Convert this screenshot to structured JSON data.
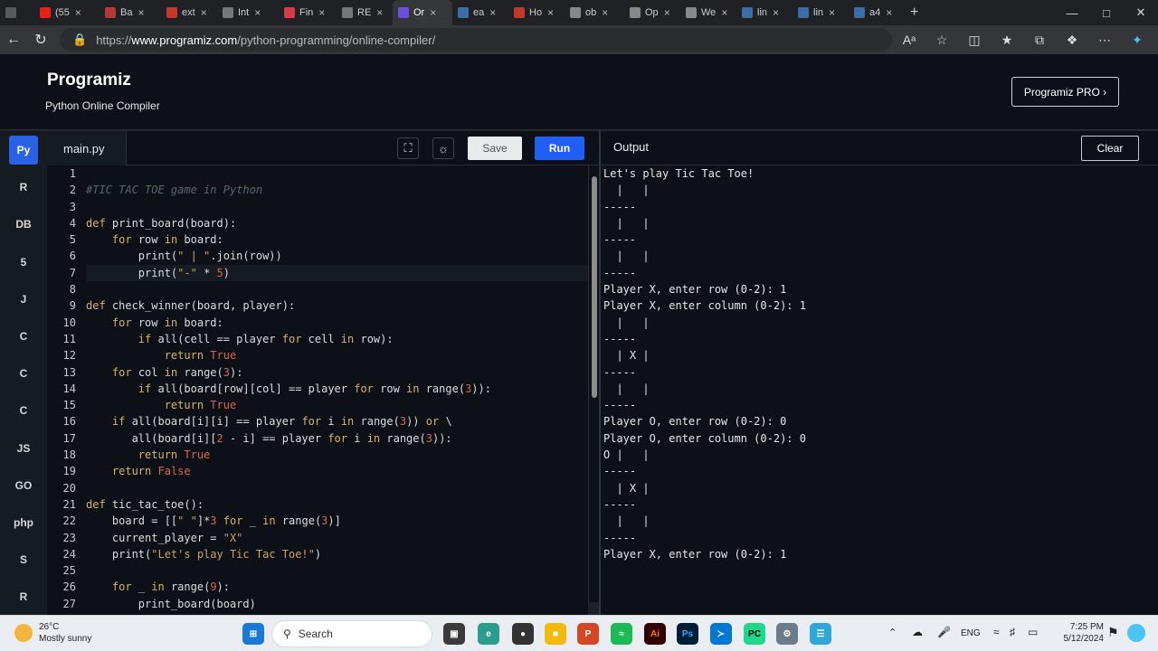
{
  "browser": {
    "tabs": [
      {
        "label": "",
        "color": "#5a5a5a"
      },
      {
        "label": "(55",
        "color": "#e62117"
      },
      {
        "label": "Ba",
        "color": "#b23a3a"
      },
      {
        "label": "ext",
        "color": "#c0392b"
      },
      {
        "label": "Int",
        "color": "#777777"
      },
      {
        "label": "Fin",
        "color": "#d33c4b"
      },
      {
        "label": "RE",
        "color": "#777777"
      },
      {
        "label": "Or",
        "color": "#6b4fd8"
      },
      {
        "label": "ea",
        "color": "#3a6ea5"
      },
      {
        "label": "Ho",
        "color": "#c0392b"
      },
      {
        "label": "ob",
        "color": "#888888"
      },
      {
        "label": "Op",
        "color": "#888888"
      },
      {
        "label": "We",
        "color": "#888888"
      },
      {
        "label": "lin",
        "color": "#3a6ea5"
      },
      {
        "label": "lin",
        "color": "#3a6ea5"
      },
      {
        "label": "a4",
        "color": "#3a6ea5"
      }
    ],
    "url_prefix": "https://",
    "url_domain": "www.programiz.com",
    "url_path": "/python-programming/online-compiler/"
  },
  "site": {
    "logo": "Programiz",
    "subtitle": "Python Online Compiler",
    "pro_button": "Programiz PRO ›"
  },
  "sidebar": {
    "items": [
      {
        "name": "python-icon",
        "glyph": "Py"
      },
      {
        "name": "r-icon",
        "glyph": "R"
      },
      {
        "name": "sql-icon",
        "glyph": "DB"
      },
      {
        "name": "html-icon",
        "glyph": "5"
      },
      {
        "name": "java-icon",
        "glyph": "J"
      },
      {
        "name": "c-icon",
        "glyph": "C"
      },
      {
        "name": "cpp-icon",
        "glyph": "C"
      },
      {
        "name": "csharp-icon",
        "glyph": "C"
      },
      {
        "name": "js-icon",
        "glyph": "JS"
      },
      {
        "name": "go-icon",
        "glyph": "GO"
      },
      {
        "name": "php-icon",
        "glyph": "php"
      },
      {
        "name": "swift-icon",
        "glyph": "S"
      },
      {
        "name": "rust-icon",
        "glyph": "R"
      }
    ]
  },
  "editor": {
    "filename": "main.py",
    "save_label": "Save",
    "run_label": "Run",
    "line_numbers": [
      "1",
      "2",
      "3",
      "4",
      "5",
      "6",
      "7",
      "8",
      "9",
      "10",
      "11",
      "12",
      "13",
      "14",
      "15",
      "16",
      "17",
      "18",
      "19",
      "20",
      "21",
      "22",
      "23",
      "24",
      "25",
      "26",
      "27"
    ],
    "lines": [
      [],
      [
        [
          "#TIC TAC TOE game in Python",
          "comment"
        ]
      ],
      [],
      [
        [
          "def",
          "kw"
        ],
        [
          " print_board(board):",
          ""
        ]
      ],
      [
        [
          "    ",
          ""
        ],
        [
          "for",
          "kw"
        ],
        [
          " row ",
          ""
        ],
        [
          "in",
          "kw"
        ],
        [
          " board:",
          ""
        ]
      ],
      [
        [
          "        print(",
          ""
        ],
        [
          "\" | \"",
          "str"
        ],
        [
          ".join(row))",
          ""
        ]
      ],
      [
        [
          "        print(",
          ""
        ],
        [
          "\"-\"",
          "str"
        ],
        [
          " * ",
          ""
        ],
        [
          "5",
          "lit"
        ],
        [
          ")",
          ""
        ]
      ],
      [],
      [
        [
          "def",
          "kw"
        ],
        [
          " check_winner(board, player):",
          ""
        ]
      ],
      [
        [
          "    ",
          ""
        ],
        [
          "for",
          "kw"
        ],
        [
          " row ",
          ""
        ],
        [
          "in",
          "kw"
        ],
        [
          " board:",
          ""
        ]
      ],
      [
        [
          "        ",
          ""
        ],
        [
          "if",
          "kw"
        ],
        [
          " all(cell == player ",
          ""
        ],
        [
          "for",
          "kw"
        ],
        [
          " cell ",
          ""
        ],
        [
          "in",
          "kw"
        ],
        [
          " row):",
          ""
        ]
      ],
      [
        [
          "            ",
          ""
        ],
        [
          "return",
          "kw"
        ],
        [
          " ",
          ""
        ],
        [
          "True",
          "lit"
        ]
      ],
      [
        [
          "    ",
          ""
        ],
        [
          "for",
          "kw"
        ],
        [
          " col ",
          ""
        ],
        [
          "in",
          "kw"
        ],
        [
          " range(",
          ""
        ],
        [
          "3",
          "lit"
        ],
        [
          "):",
          ""
        ]
      ],
      [
        [
          "        ",
          ""
        ],
        [
          "if",
          "kw"
        ],
        [
          " all(board[row][col] == player ",
          ""
        ],
        [
          "for",
          "kw"
        ],
        [
          " row ",
          ""
        ],
        [
          "in",
          "kw"
        ],
        [
          " range(",
          ""
        ],
        [
          "3",
          "lit"
        ],
        [
          ")):",
          ""
        ]
      ],
      [
        [
          "            ",
          ""
        ],
        [
          "return",
          "kw"
        ],
        [
          " ",
          ""
        ],
        [
          "True",
          "lit"
        ]
      ],
      [
        [
          "    ",
          ""
        ],
        [
          "if",
          "kw"
        ],
        [
          " all(board[i][i] == player ",
          ""
        ],
        [
          "for",
          "kw"
        ],
        [
          " i ",
          ""
        ],
        [
          "in",
          "kw"
        ],
        [
          " range(",
          ""
        ],
        [
          "3",
          "lit"
        ],
        [
          ")) ",
          ""
        ],
        [
          "or",
          "kw"
        ],
        [
          " \\",
          ""
        ]
      ],
      [
        [
          "       all(board[i][",
          ""
        ],
        [
          "2",
          "lit"
        ],
        [
          " - i] == player ",
          ""
        ],
        [
          "for",
          "kw"
        ],
        [
          " i ",
          ""
        ],
        [
          "in",
          "kw"
        ],
        [
          " range(",
          ""
        ],
        [
          "3",
          "lit"
        ],
        [
          ")):",
          ""
        ]
      ],
      [
        [
          "        ",
          ""
        ],
        [
          "return",
          "kw"
        ],
        [
          " ",
          ""
        ],
        [
          "True",
          "lit"
        ]
      ],
      [
        [
          "    ",
          ""
        ],
        [
          "return",
          "kw"
        ],
        [
          " ",
          ""
        ],
        [
          "False",
          "lit"
        ]
      ],
      [],
      [
        [
          "def",
          "kw"
        ],
        [
          " tic_tac_toe():",
          ""
        ]
      ],
      [
        [
          "    board = [[",
          ""
        ],
        [
          "\" \"",
          "str"
        ],
        [
          "]*",
          ""
        ],
        [
          "3",
          "lit"
        ],
        [
          " ",
          ""
        ],
        [
          "for",
          "kw"
        ],
        [
          " _ ",
          ""
        ],
        [
          "in",
          "kw"
        ],
        [
          " range(",
          ""
        ],
        [
          "3",
          "lit"
        ],
        [
          ")]",
          ""
        ]
      ],
      [
        [
          "    current_player = ",
          ""
        ],
        [
          "\"X\"",
          "str"
        ]
      ],
      [
        [
          "    print(",
          ""
        ],
        [
          "\"Let's play Tic Tac Toe!\"",
          "str"
        ],
        [
          ")",
          ""
        ]
      ],
      [],
      [
        [
          "    ",
          ""
        ],
        [
          "for",
          "kw"
        ],
        [
          " _ ",
          ""
        ],
        [
          "in",
          "kw"
        ],
        [
          " range(",
          ""
        ],
        [
          "9",
          "lit"
        ],
        [
          "):",
          ""
        ]
      ],
      [
        [
          "        print_board(board)",
          ""
        ]
      ]
    ]
  },
  "output": {
    "title": "Output",
    "clear_label": "Clear",
    "lines": [
      "Let's play Tic Tac Toe!",
      "  |   |  ",
      "-----",
      "  |   |  ",
      "-----",
      "  |   |  ",
      "-----",
      "Player X, enter row (0-2): 1",
      "Player X, enter column (0-2): 1",
      "  |   |  ",
      "-----",
      "  | X |  ",
      "-----",
      "  |   |  ",
      "-----",
      "Player O, enter row (0-2): 0",
      "Player O, enter column (0-2): 0",
      "O |   |  ",
      "-----",
      "  | X |  ",
      "-----",
      "  |   |  ",
      "-----",
      "Player X, enter row (0-2): 1"
    ]
  },
  "taskbar": {
    "temp": "26°C",
    "weather": "Mostly sunny",
    "search_placeholder": "Search",
    "lang": "ENG",
    "time": "7:25 PM",
    "date": "5/12/2024"
  }
}
